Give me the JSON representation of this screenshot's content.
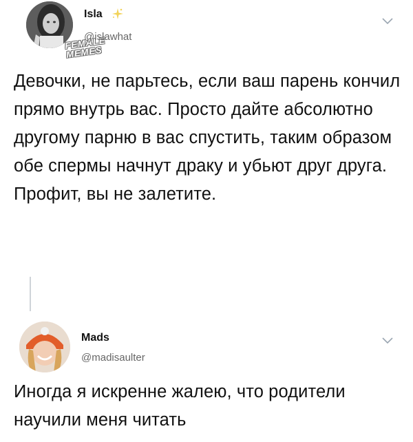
{
  "tweet1": {
    "name": "Isla",
    "handle": "@islawhat",
    "text": "Девочки, не парьтесь, если ваш парень кончил прямо внутрь вас. Просто дайте абсолютно другому парню в вас спустить, таким образом обе спермы начнут драку и убьют друг друга. Профит, вы не залетите.",
    "name_badge_icon": "sparkle-icon"
  },
  "watermark": {
    "line1": "FEMALE",
    "line2": "MEMES"
  },
  "tweet2": {
    "name": "Mads",
    "handle": "@madisaulter",
    "text": "Иногда я искренне жалею, что родители научили меня читать"
  },
  "colors": {
    "text": "#111111",
    "handle": "#666666",
    "thread_line": "#cfd4d9",
    "chevron": "#9aa5b1"
  }
}
